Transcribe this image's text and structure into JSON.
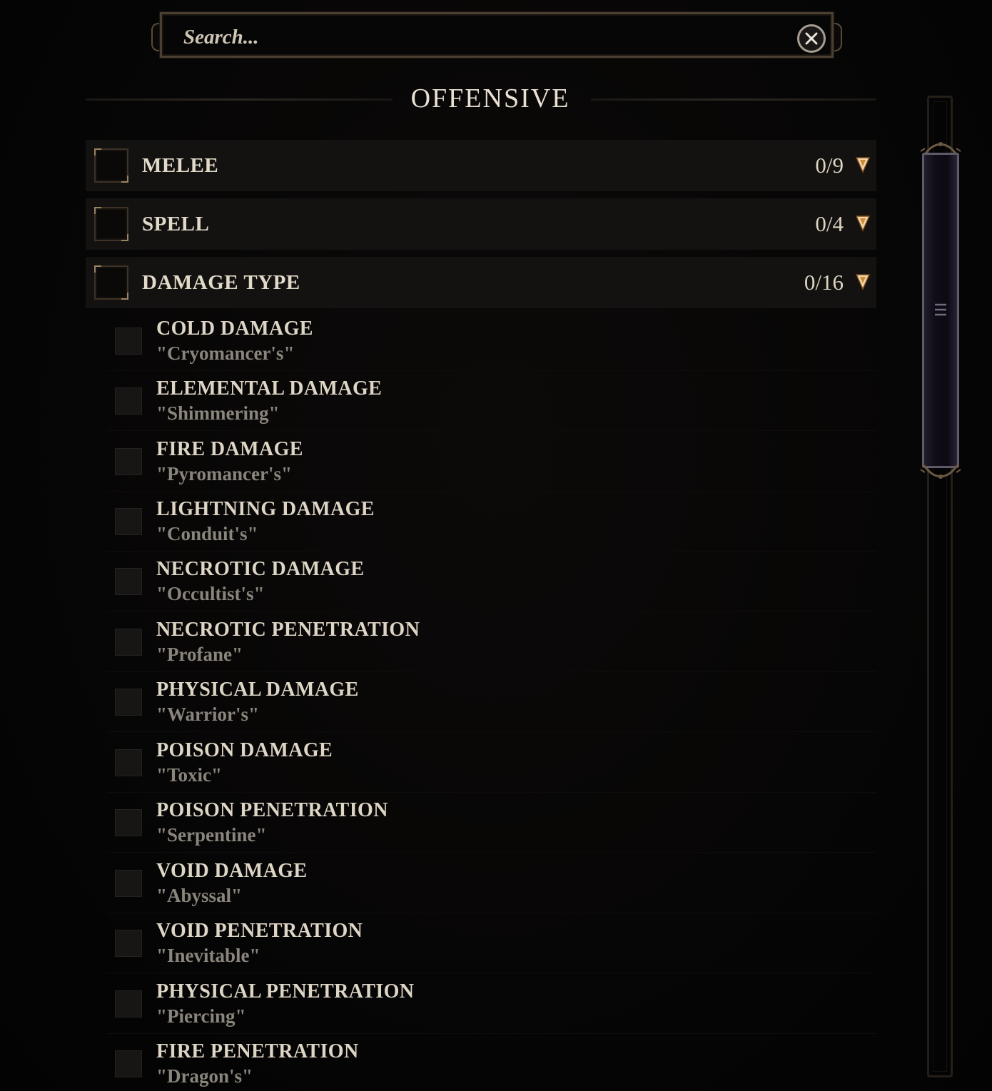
{
  "search": {
    "placeholder": "Search...",
    "clear_icon": "close-circle-icon"
  },
  "section": {
    "title": "OFFENSIVE"
  },
  "categories": [
    {
      "label": "MELEE",
      "count": "0/9",
      "expanded": false
    },
    {
      "label": "SPELL",
      "count": "0/4",
      "expanded": false
    },
    {
      "label": "DAMAGE TYPE",
      "count": "0/16",
      "expanded": true
    }
  ],
  "damage_type_items": [
    {
      "title": "COLD DAMAGE",
      "affix": "\"Cryomancer's\""
    },
    {
      "title": "ELEMENTAL DAMAGE",
      "affix": "\"Shimmering\""
    },
    {
      "title": "FIRE DAMAGE",
      "affix": "\"Pyromancer's\""
    },
    {
      "title": "LIGHTNING DAMAGE",
      "affix": "\"Conduit's\""
    },
    {
      "title": "NECROTIC DAMAGE",
      "affix": "\"Occultist's\""
    },
    {
      "title": "NECROTIC PENETRATION",
      "affix": "\"Profane\""
    },
    {
      "title": "PHYSICAL DAMAGE",
      "affix": "\"Warrior's\""
    },
    {
      "title": "POISON DAMAGE",
      "affix": "\"Toxic\""
    },
    {
      "title": "POISON PENETRATION",
      "affix": "\"Serpentine\""
    },
    {
      "title": "VOID DAMAGE",
      "affix": "\"Abyssal\""
    },
    {
      "title": "VOID PENETRATION",
      "affix": "\"Inevitable\""
    },
    {
      "title": "PHYSICAL PENETRATION",
      "affix": "\"Piercing\""
    },
    {
      "title": "FIRE PENETRATION",
      "affix": "\"Dragon's\""
    }
  ],
  "colors": {
    "accent_arrow": "#f2d6a8",
    "frame_gold": "#9a8360",
    "scroll_thumb": "#1a1524"
  }
}
